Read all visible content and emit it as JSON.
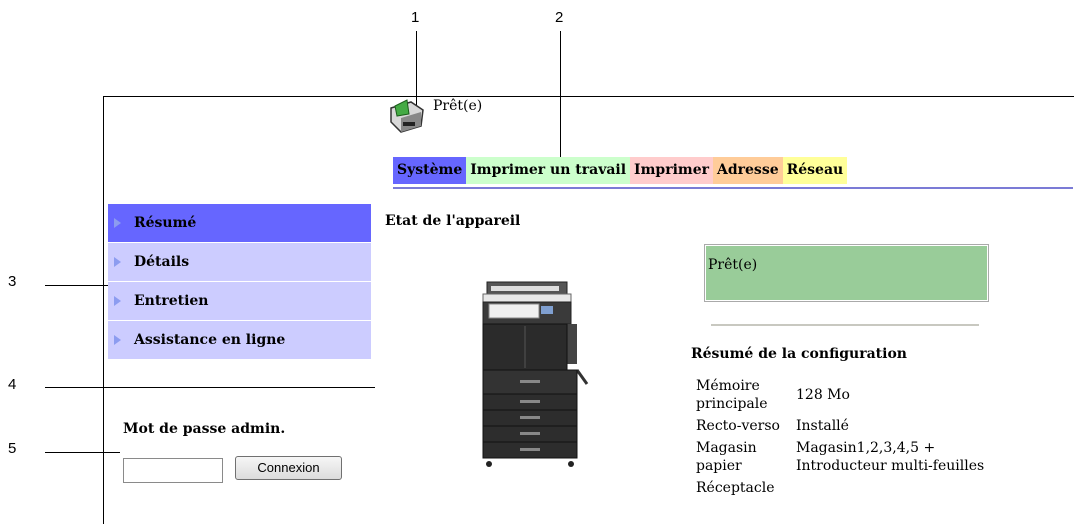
{
  "callouts": [
    "1",
    "2",
    "3",
    "4",
    "5"
  ],
  "status": {
    "text": "Prêt(e)"
  },
  "tabs": [
    {
      "label": "Système",
      "color": "#6666ff"
    },
    {
      "label": "Imprimer un travail",
      "color": "#ccffcc"
    },
    {
      "label": "Imprimer",
      "color": "#ffcccc"
    },
    {
      "label": "Adresse",
      "color": "#ffcc99"
    },
    {
      "label": "Réseau",
      "color": "#ffff99"
    }
  ],
  "menu": {
    "items": [
      {
        "label": "Résumé",
        "active": true
      },
      {
        "label": "Détails",
        "active": false
      },
      {
        "label": "Entretien",
        "active": false
      },
      {
        "label": "Assistance en ligne",
        "active": false
      }
    ]
  },
  "admin": {
    "title": "Mot de passe admin.",
    "password_value": "",
    "login_label": "Connexion"
  },
  "main": {
    "title": "Etat de l'appareil",
    "status_box": "Prêt(e)",
    "config_title": "Résumé de la configuration",
    "config": [
      {
        "key": "Mémoire principale",
        "value": "128 Mo"
      },
      {
        "key": "Recto-verso",
        "value": "Installé"
      },
      {
        "key": "Magasin papier",
        "value": "Magasin1,2,3,4,5 + Introducteur multi-feuilles"
      },
      {
        "key": "Réceptacle",
        "value": ""
      }
    ]
  }
}
